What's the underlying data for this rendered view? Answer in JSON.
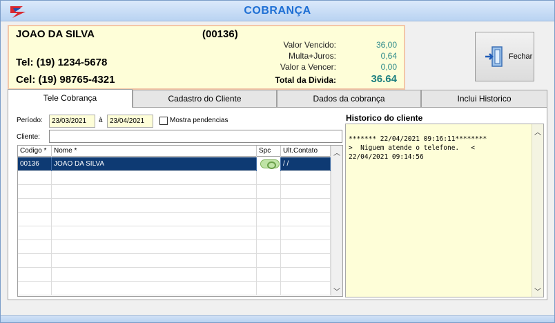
{
  "window": {
    "title": "COBRANÇA"
  },
  "client": {
    "name": "JOAO DA SILVA",
    "code": "(00136)",
    "tel": "Tel: (19) 1234-5678",
    "cel": "Cel: (19) 98765-4321"
  },
  "finance": {
    "vencido_label": "Valor Vencido:",
    "vencido_value": "36,00",
    "multa_label": "Multa+Juros:",
    "multa_value": "0,64",
    "vencer_label": "Valor a Vencer:",
    "vencer_value": "0,00",
    "total_label": "Total da Divida:",
    "total_value": "36.64"
  },
  "fechar_button": {
    "label": "Fechar",
    "icon": "door-exit-icon"
  },
  "tabs": [
    {
      "label": "Tele Cobrança",
      "active": true
    },
    {
      "label": "Cadastro do Cliente",
      "active": false
    },
    {
      "label": "Dados da cobrança",
      "active": false
    },
    {
      "label": "Inclui Historico",
      "active": false
    }
  ],
  "filters": {
    "periodo_label": "Período:",
    "date_from": "23/03/2021",
    "ate_label": "à",
    "date_to": "23/04/2021",
    "mostra_label": "Mostra pendencias",
    "cliente_label": "Cliente:",
    "cliente_value": ""
  },
  "grid": {
    "columns": [
      "Codigo *",
      "Nome *",
      "Spc",
      "Ult.Contato"
    ],
    "rows": [
      {
        "codigo": "00136",
        "nome": "JOAO DA SILVA",
        "spc": "spc-indicator-icon",
        "ult_contato": "/ /"
      }
    ]
  },
  "historico": {
    "title": "Historico do cliente",
    "text": "******* 22/04/2021 09:16:11********\n>  Niguem atende o telefone.   <\n22/04/2021 09:14:56"
  }
}
